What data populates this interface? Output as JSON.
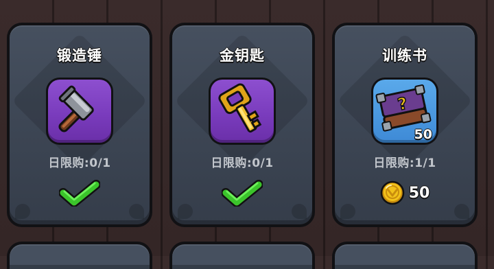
{
  "shop": {
    "items": [
      {
        "name": "锻造锤",
        "icon": "hammer-icon",
        "icon_bg": "#7a3cbd",
        "limit_text": "日限购:0/1",
        "state": "purchased"
      },
      {
        "name": "金钥匙",
        "icon": "golden-key-icon",
        "icon_bg": "#7a3cbd",
        "limit_text": "日限购:0/1",
        "state": "purchased"
      },
      {
        "name": "训练书",
        "icon": "training-book-icon",
        "icon_bg": "#3e8ad6",
        "quantity": "50",
        "limit_text": "日限购:1/1",
        "state": "for-sale",
        "price": "50",
        "currency_icon": "gold-coin-icon"
      }
    ]
  },
  "colors": {
    "card": "#3c4553",
    "check": "#4ee23a",
    "coin": "#f2c21b"
  }
}
